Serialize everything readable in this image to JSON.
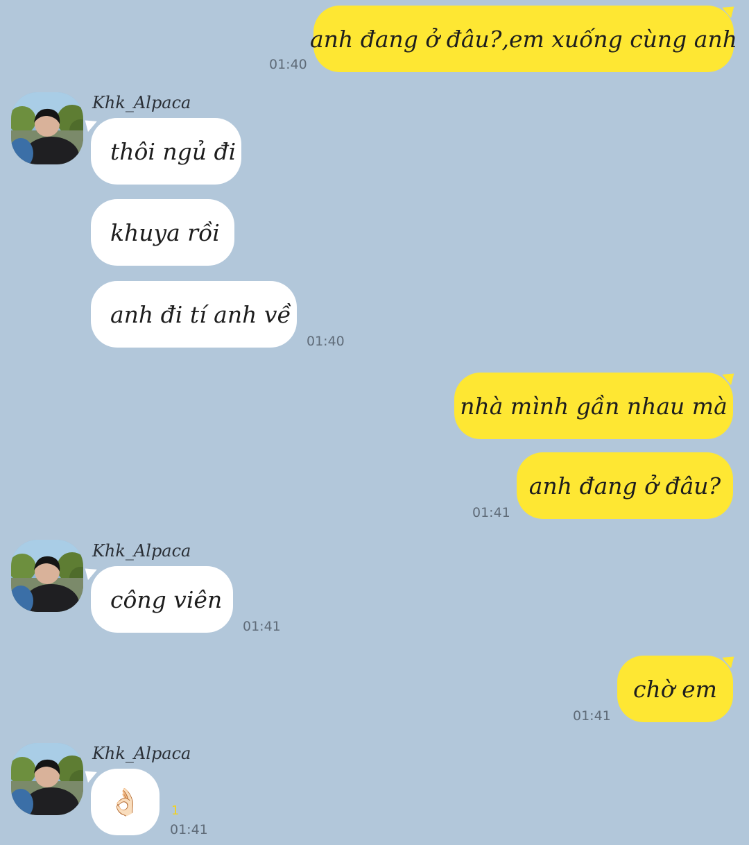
{
  "colors": {
    "background": "#b2c7da",
    "my_bubble": "#fee733",
    "their_bubble": "#ffffff",
    "time_text": "#5f6b78",
    "unread_count": "#f2d21e"
  },
  "contact": {
    "name": "Khk_Alpaca",
    "avatar_icon": "profile-photo-avatar"
  },
  "messages": [
    {
      "from": "me",
      "text": "anh đang ở đâu?,em xuống cùng anh",
      "time": "01:40"
    },
    {
      "from": "contact",
      "sender": "Khk_Alpaca",
      "text": "thôi ngủ đi"
    },
    {
      "from": "contact",
      "text": "khuya rồi"
    },
    {
      "from": "contact",
      "text": "anh đi tí anh về",
      "time": "01:40"
    },
    {
      "from": "me",
      "text": "nhà mình gần nhau mà"
    },
    {
      "from": "me",
      "text": "anh đang ở đâu?",
      "time": "01:41"
    },
    {
      "from": "contact",
      "sender": "Khk_Alpaca",
      "text": "công viên",
      "time": "01:41"
    },
    {
      "from": "me",
      "text": "chờ em",
      "time": "01:41"
    },
    {
      "from": "contact",
      "sender": "Khk_Alpaca",
      "text": "👌🏻",
      "emoji_icon": "ok-hand-emoji-icon",
      "unread": "1",
      "time": "01:41"
    }
  ]
}
